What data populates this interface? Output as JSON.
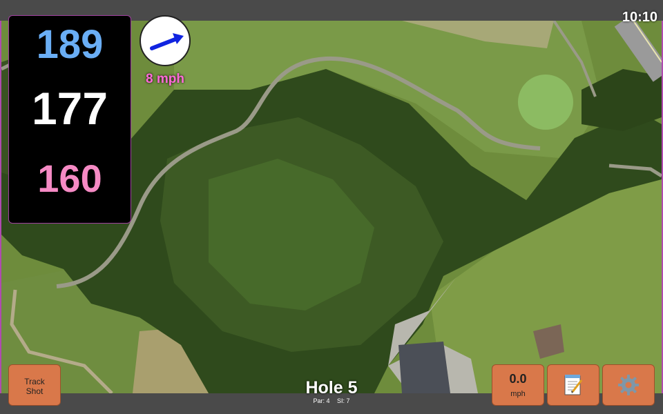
{
  "status": {
    "time": "10:10"
  },
  "distances": {
    "back": "189",
    "center": "177",
    "front": "160"
  },
  "wind": {
    "speed": "8 mph",
    "icon": "wind-arrow-icon"
  },
  "hole": {
    "title": "Hole 5",
    "par": "Par: 4",
    "si": "SI: 7"
  },
  "buttons": {
    "track_shot": "Track\nShot",
    "speed_value": "0.0",
    "speed_unit": "mph",
    "notes_icon": "notepad-icon",
    "settings_icon": "gear-icon"
  },
  "colors": {
    "back": "#6aaef5",
    "center": "#ffffff",
    "front": "#f58ac4",
    "wind_label": "#ff6ad8",
    "button": "#d9784a"
  }
}
